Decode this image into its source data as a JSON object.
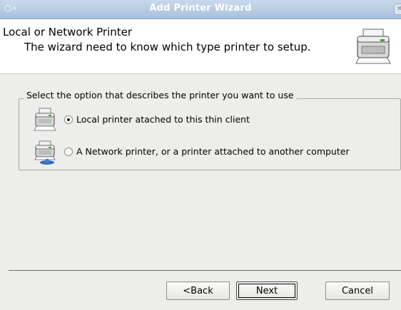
{
  "window": {
    "title": "Add Printer Wizard",
    "menu_icon": "window-menu-icon",
    "close_icon": "close-icon"
  },
  "header": {
    "title": "Local or Network Printer",
    "description": "The wizard need to know which type printer to setup.",
    "icon": "printer-icon"
  },
  "group": {
    "legend": "Select the option that describes the printer you want to use",
    "options": [
      {
        "label": "Local printer atached to this thin client",
        "selected": true,
        "icon": "local-printer-icon"
      },
      {
        "label": "A Network printer, or a printer attached to another computer",
        "selected": false,
        "icon": "network-printer-icon"
      }
    ]
  },
  "buttons": {
    "back": "<Back",
    "next": "Next",
    "cancel": "Cancel"
  }
}
